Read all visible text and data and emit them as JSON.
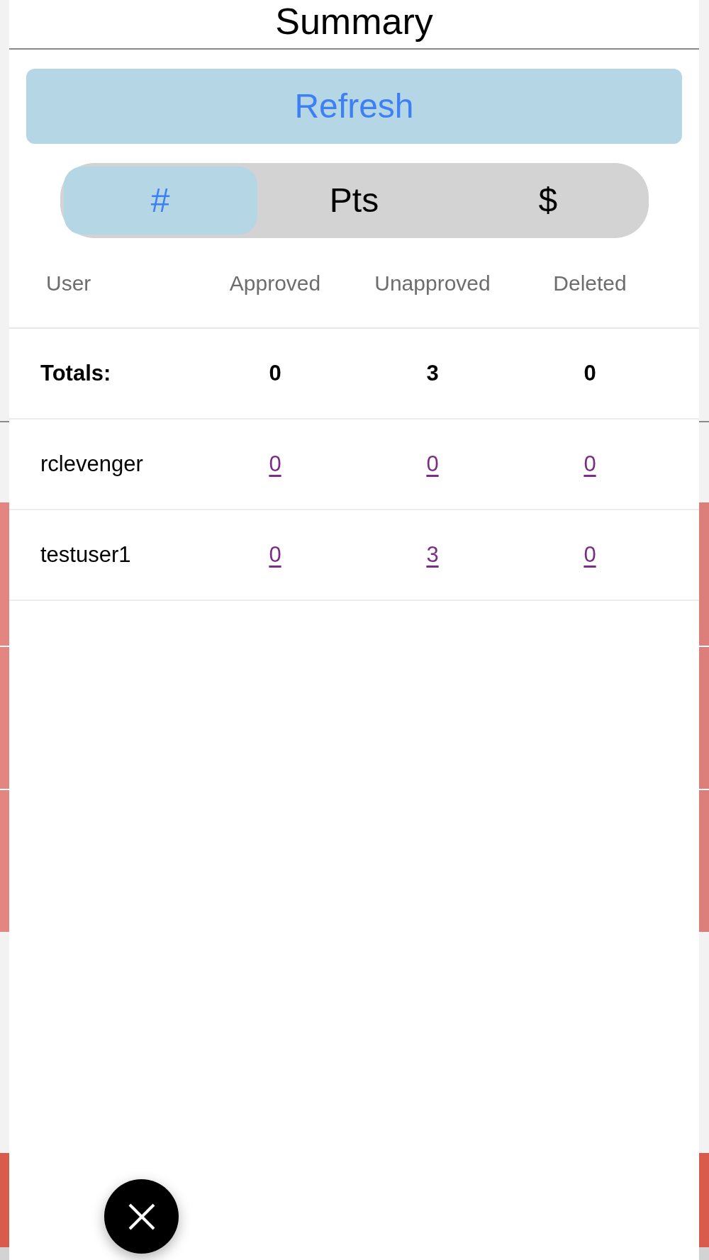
{
  "header": {
    "title": "Summary"
  },
  "refresh_button": {
    "label": "Refresh"
  },
  "segments": [
    {
      "label": "#",
      "selected": true
    },
    {
      "label": "Pts",
      "selected": false
    },
    {
      "label": "$",
      "selected": false
    }
  ],
  "table": {
    "columns": [
      "User",
      "Approved",
      "Unapproved",
      "Deleted"
    ],
    "totals": {
      "label": "Totals:",
      "values": [
        "0",
        "3",
        "0"
      ]
    },
    "rows": [
      {
        "user": "rclevenger",
        "values": [
          "0",
          "0",
          "0"
        ]
      },
      {
        "user": "testuser1",
        "values": [
          "0",
          "3",
          "0"
        ]
      }
    ]
  }
}
